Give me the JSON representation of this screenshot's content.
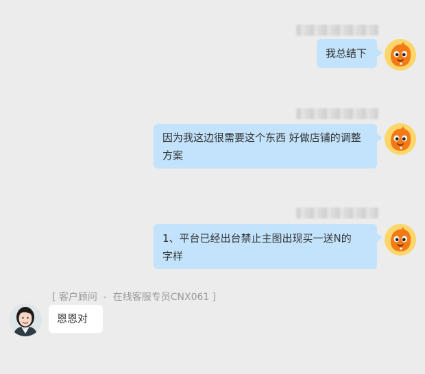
{
  "chat": {
    "outgoing": [
      {
        "text": "我总结下"
      },
      {
        "line1": "因为我这边很需要这个东西 好做店铺的调整",
        "line2": "方案"
      },
      {
        "line1": "1、平台已经出台禁止主图出现买一送N的",
        "line2": "字样"
      }
    ],
    "agent": {
      "header": "[ 客户顾问  -  在线客服专员CNX061 ]",
      "reply": "恩恩对"
    }
  },
  "icons": {
    "user_avatar": "orange-mascot-avatar-icon",
    "agent_avatar": "agent-photo-avatar"
  },
  "colors": {
    "background": "#ececec",
    "outgoing_bubble": "#c2e3fb",
    "incoming_bubble": "#ffffff",
    "mascot_orange": "#f47a16",
    "header_text": "#999999"
  }
}
